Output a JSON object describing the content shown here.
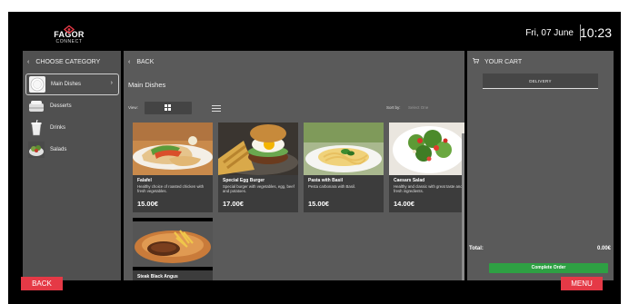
{
  "header": {
    "brand": "FAGOR",
    "brand_sub": "CONNECT",
    "date": "Fri, 07 June",
    "time": "10:23"
  },
  "category_panel": {
    "title": "CHOOSE CATEGORY",
    "items": [
      {
        "label": "Main Dishes",
        "active": true
      },
      {
        "label": "Desserts",
        "active": false
      },
      {
        "label": "Drinks",
        "active": false
      },
      {
        "label": "Salads",
        "active": false
      }
    ]
  },
  "main_panel": {
    "back_label": "BACK",
    "title": "Main Dishes",
    "view_label": "View:",
    "sort_label": "Sort by:",
    "sort_value": "Select One",
    "products": [
      {
        "name": "Falafel",
        "description": "Healthy choice of roasted chicken with fresh vegetables.",
        "price": "15.00€"
      },
      {
        "name": "Special Egg Burger",
        "description": "Special burger with vegetables, egg, beef and potatoes.",
        "price": "17.00€"
      },
      {
        "name": "Pasta with Basil",
        "description": "Pesta carbonara with Basil.",
        "price": "15.00€"
      },
      {
        "name": "Caesars Salad",
        "description": "Healthy and classic with great taste and fresh ingredients.",
        "price": "14.00€"
      },
      {
        "name": "Steak Black Angus",
        "description": "",
        "price": ""
      }
    ]
  },
  "cart_panel": {
    "title": "YOUR CART",
    "delivery_tab": "DELIVERY",
    "total_label": "Total:",
    "total_value": "0.00€",
    "complete_label": "Complete Order"
  },
  "footer": {
    "back_label": "BACK",
    "menu_label": "MENU"
  },
  "colors": {
    "accent_red": "#e53946",
    "complete_green": "#2ea043",
    "panel_gray": "#5a5a5a",
    "background_black": "#000000"
  }
}
